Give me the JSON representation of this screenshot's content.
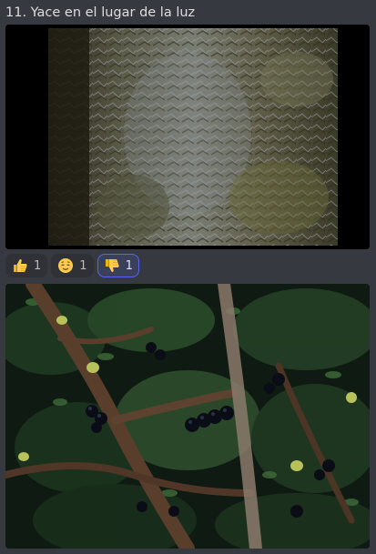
{
  "message": {
    "title": "11. Yace en el lugar de la luz"
  },
  "reactions": [
    {
      "emoji": "thumbs-up",
      "count": "1",
      "selected": false
    },
    {
      "emoji": "relieved-face",
      "count": "1",
      "selected": false
    },
    {
      "emoji": "thumbs-down",
      "count": "1",
      "selected": true
    }
  ],
  "colors": {
    "background": "#36393f",
    "reaction_bg": "#2f3136",
    "reaction_selected_bg": "#3b405a",
    "reaction_selected_border": "#5865f2"
  }
}
